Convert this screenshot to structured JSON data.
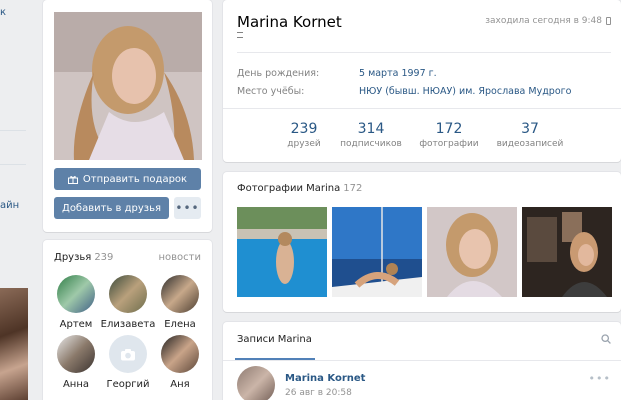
{
  "left_nav": {
    "item_1": "к",
    "item_2": "айн"
  },
  "profile": {
    "name": "Marina Kornet",
    "online_text": "заходила сегодня в 9:48",
    "details": [
      {
        "label": "День рождения:",
        "value": "5 марта 1997 г."
      },
      {
        "label": "Место учёбы:",
        "value": "НЮУ (бывш. НЮАУ) им. Ярослава Мудрого"
      }
    ],
    "counters": [
      {
        "num": "239",
        "label": "друзей"
      },
      {
        "num": "314",
        "label": "подписчиков"
      },
      {
        "num": "172",
        "label": "фотографии"
      },
      {
        "num": "37",
        "label": "видеозаписей"
      }
    ]
  },
  "actions": {
    "gift_label": "Отправить подарок",
    "add_friend_label": "Добавить в друзья",
    "more_label": "•••"
  },
  "friends": {
    "title": "Друзья",
    "count": "239",
    "news_label": "новости",
    "items": [
      {
        "name": "Артем"
      },
      {
        "name": "Елизавета"
      },
      {
        "name": "Елена"
      },
      {
        "name": "Анна"
      },
      {
        "name": "Георгий"
      },
      {
        "name": "Аня"
      }
    ]
  },
  "photos": {
    "title": "Фотографии Marina",
    "count": "172"
  },
  "wall": {
    "tab_label": "Записи Marina",
    "post": {
      "author": "Marina Kornet",
      "date": "26 авг в 20:58",
      "more_label": "•••"
    }
  },
  "colors": {
    "accent": "#5e81a8",
    "link": "#2a5885",
    "background": "#edeef0"
  }
}
